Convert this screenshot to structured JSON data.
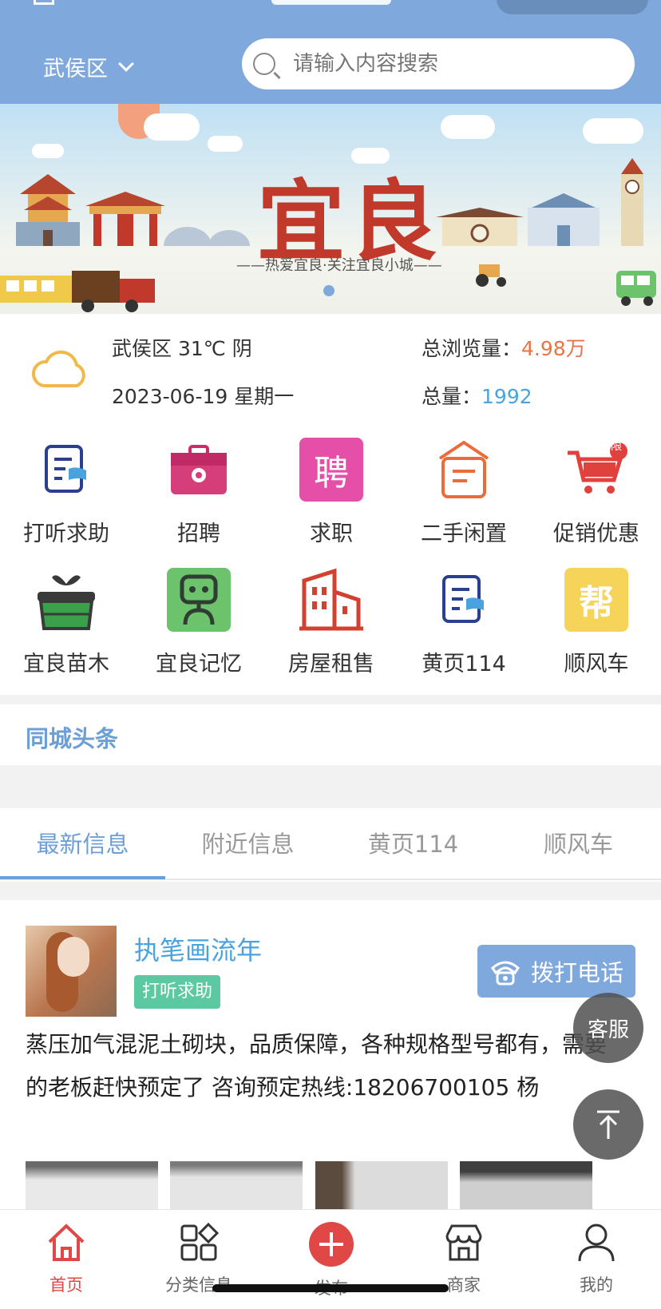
{
  "header": {
    "location": "武侯区",
    "search_placeholder": "请输入内容搜索"
  },
  "banner": {
    "title": "宜良",
    "subtitle": "——热爱宜良·关注宜良小城——"
  },
  "weather": {
    "line1": "武侯区 31℃ 阴",
    "line2": "2023-06-19 星期一"
  },
  "stats": {
    "views_label": "总浏览量：",
    "views_value": "4.98万",
    "total_label": "总量：",
    "total_value": "1992"
  },
  "grid": [
    {
      "label": "打听求助",
      "icon": "notepad-flag-icon"
    },
    {
      "label": "招聘",
      "icon": "briefcase-gear-icon"
    },
    {
      "label": "求职",
      "icon": "pin-glyph-icon",
      "glyph": "聘"
    },
    {
      "label": "二手闲置",
      "icon": "box-icon"
    },
    {
      "label": "促销优惠",
      "icon": "cart-limit-icon",
      "badge": "限"
    },
    {
      "label": "宜良苗木",
      "icon": "plant-basket-icon"
    },
    {
      "label": "宜良记忆",
      "icon": "robot-icon"
    },
    {
      "label": "房屋租售",
      "icon": "building-icon"
    },
    {
      "label": "黄页114",
      "icon": "notepad-flag-icon"
    },
    {
      "label": "顺风车",
      "icon": "help-glyph-icon",
      "glyph": "帮"
    }
  ],
  "headline": {
    "label": "同城头条"
  },
  "tabs": [
    "最新信息",
    "附近信息",
    "黄页114",
    "顺风车"
  ],
  "post": {
    "user": "执笔画流年",
    "tag": "打听求助",
    "call_label": "拨打电话",
    "content": "蒸压加气混泥土砌块，品质保障，各种规格型号都有，需要的老板赶快预定了 咨询预定热线:18206700105 杨"
  },
  "floating": {
    "service": "客服"
  },
  "tabbar": [
    {
      "label": "首页",
      "icon": "home-icon"
    },
    {
      "label": "分类信息",
      "icon": "category-icon"
    },
    {
      "label": "发布",
      "icon": "plus-icon"
    },
    {
      "label": "商家",
      "icon": "store-icon"
    },
    {
      "label": "我的",
      "icon": "user-icon"
    }
  ],
  "colors": {
    "primary": "#7fa9dd",
    "accent_red": "#e04848",
    "orange": "#e8744a",
    "blue": "#4aa3df"
  }
}
